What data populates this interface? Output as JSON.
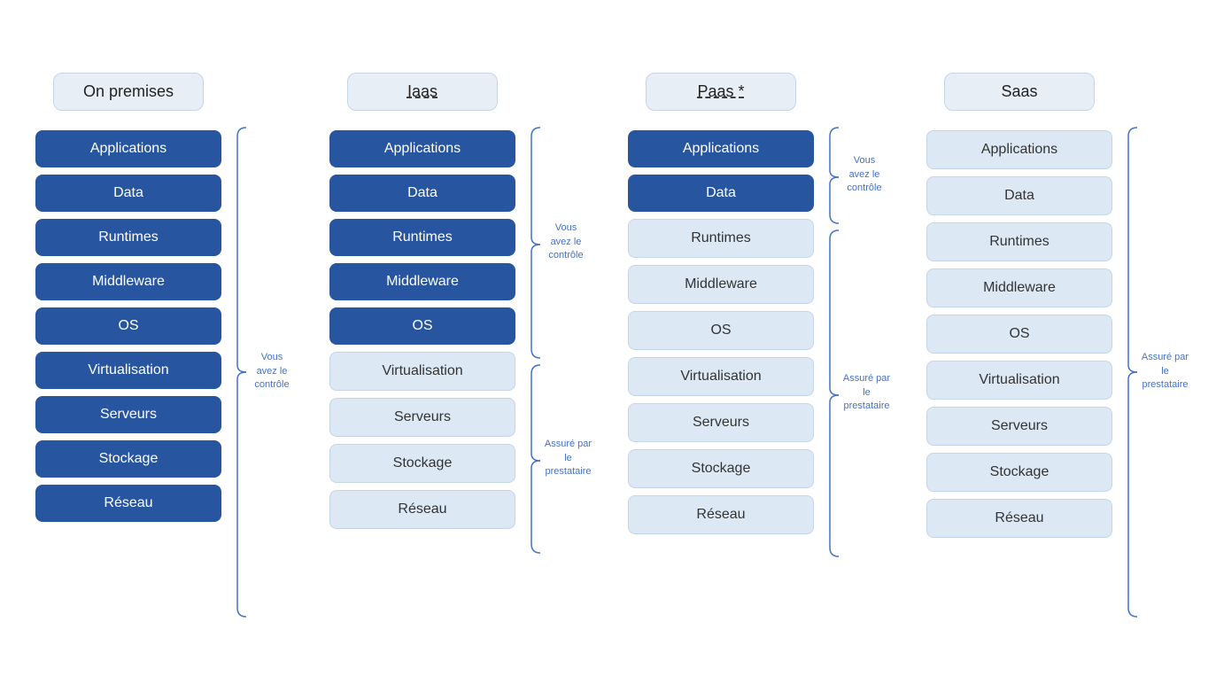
{
  "columns": [
    {
      "id": "on-premises",
      "title": "On premises",
      "title_style": "normal",
      "items": [
        {
          "label": "Applications",
          "style": "dark"
        },
        {
          "label": "Data",
          "style": "dark"
        },
        {
          "label": "Runtimes",
          "style": "dark"
        },
        {
          "label": "Middleware",
          "style": "dark"
        },
        {
          "label": "OS",
          "style": "dark"
        },
        {
          "label": "Virtualisation",
          "style": "dark"
        },
        {
          "label": "Serveurs",
          "style": "dark"
        },
        {
          "label": "Stockage",
          "style": "dark"
        },
        {
          "label": "Réseau",
          "style": "dark"
        }
      ],
      "annotation": {
        "text": "Vous avez le contrôle",
        "from_index": 0,
        "to_index": 8
      }
    },
    {
      "id": "iaas",
      "title": "Iaas",
      "title_style": "underline",
      "items": [
        {
          "label": "Applications",
          "style": "dark"
        },
        {
          "label": "Data",
          "style": "dark"
        },
        {
          "label": "Runtimes",
          "style": "dark"
        },
        {
          "label": "Middleware",
          "style": "dark"
        },
        {
          "label": "OS",
          "style": "dark"
        },
        {
          "label": "Virtualisation",
          "style": "light"
        },
        {
          "label": "Serveurs",
          "style": "light"
        },
        {
          "label": "Stockage",
          "style": "light"
        },
        {
          "label": "Réseau",
          "style": "light"
        }
      ],
      "annotations": [
        {
          "text": "Vous avez le contrôle",
          "from_index": 0,
          "to_index": 4
        },
        {
          "text": "Assuré par le prestataire",
          "from_index": 5,
          "to_index": 8
        }
      ]
    },
    {
      "id": "paas",
      "title": "Paas *",
      "title_style": "underline",
      "items": [
        {
          "label": "Applications",
          "style": "dark"
        },
        {
          "label": "Data",
          "style": "dark"
        },
        {
          "label": "Runtimes",
          "style": "light"
        },
        {
          "label": "Middleware",
          "style": "light"
        },
        {
          "label": "OS",
          "style": "light"
        },
        {
          "label": "Virtualisation",
          "style": "light"
        },
        {
          "label": "Serveurs",
          "style": "light"
        },
        {
          "label": "Stockage",
          "style": "light"
        },
        {
          "label": "Réseau",
          "style": "light"
        }
      ],
      "annotations": [
        {
          "text": "Vous avez le contrôle",
          "from_index": 0,
          "to_index": 1,
          "side": "right"
        },
        {
          "text": "Assuré par le prestataire",
          "from_index": 2,
          "to_index": 8,
          "side": "right"
        }
      ]
    },
    {
      "id": "saas",
      "title": "Saas",
      "title_style": "normal",
      "items": [
        {
          "label": "Applications",
          "style": "light"
        },
        {
          "label": "Data",
          "style": "light"
        },
        {
          "label": "Runtimes",
          "style": "light"
        },
        {
          "label": "Middleware",
          "style": "light"
        },
        {
          "label": "OS",
          "style": "light"
        },
        {
          "label": "Virtualisation",
          "style": "light"
        },
        {
          "label": "Serveurs",
          "style": "light"
        },
        {
          "label": "Stockage",
          "style": "light"
        },
        {
          "label": "Réseau",
          "style": "light"
        }
      ],
      "annotation": {
        "text": "Assuré par le prestataire",
        "from_index": 0,
        "to_index": 8,
        "side": "right"
      }
    }
  ]
}
